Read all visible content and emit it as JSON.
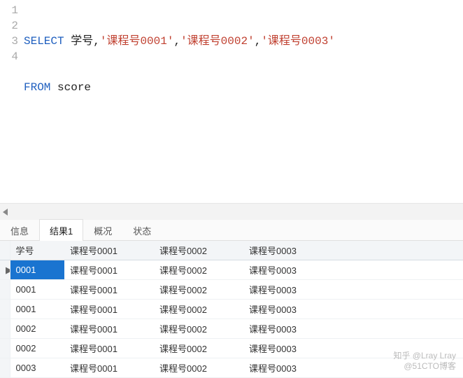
{
  "editor": {
    "line_numbers": [
      "1",
      "2",
      "3",
      "4"
    ],
    "tokens": {
      "select": "SELECT",
      "col_ident": "学号",
      "str1": "'课程号0001'",
      "str2": "'课程号0002'",
      "str3": "'课程号0003'",
      "from": "FROM",
      "table": "score"
    }
  },
  "tabs": {
    "info": "信息",
    "result1": "结果1",
    "profile": "概况",
    "status": "状态",
    "active": "result1"
  },
  "grid": {
    "headers": [
      "学号",
      "课程号0001",
      "课程号0002",
      "课程号0003"
    ],
    "rows": [
      {
        "mark": "▶",
        "selected_col": 0,
        "cells": [
          "0001",
          "课程号0001",
          "课程号0002",
          "课程号0003"
        ]
      },
      {
        "mark": "",
        "selected_col": -1,
        "cells": [
          "0001",
          "课程号0001",
          "课程号0002",
          "课程号0003"
        ]
      },
      {
        "mark": "",
        "selected_col": -1,
        "cells": [
          "0001",
          "课程号0001",
          "课程号0002",
          "课程号0003"
        ]
      },
      {
        "mark": "",
        "selected_col": -1,
        "cells": [
          "0002",
          "课程号0001",
          "课程号0002",
          "课程号0003"
        ]
      },
      {
        "mark": "",
        "selected_col": -1,
        "cells": [
          "0002",
          "课程号0001",
          "课程号0002",
          "课程号0003"
        ]
      },
      {
        "mark": "",
        "selected_col": -1,
        "cells": [
          "0003",
          "课程号0001",
          "课程号0002",
          "课程号0003"
        ]
      }
    ]
  },
  "watermark": {
    "line1": "知乎 @Lray Lray",
    "line2": "@51CTO博客"
  }
}
